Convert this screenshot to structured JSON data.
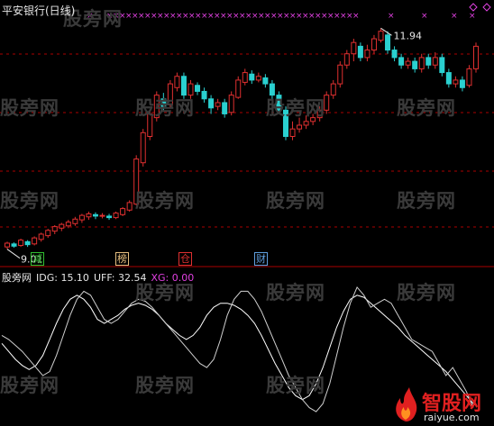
{
  "window": {
    "title": "平安银行(日线)"
  },
  "price_chart": {
    "high_label": "11.94",
    "low_label": "9.01",
    "signals": [
      {
        "text": "减",
        "color": "#30c030"
      },
      {
        "text": "榜",
        "color": "#e8c080"
      },
      {
        "text": "仓",
        "color": "#e03030"
      },
      {
        "text": "财",
        "color": "#60a0e0"
      }
    ],
    "colors": {
      "up": "#e03030",
      "down": "#2ad0d0",
      "grid": "#aa0000",
      "marker": "#e040e0"
    }
  },
  "indicator": {
    "prefix": "股旁网",
    "idg": "IDG: 15.10",
    "uff": "UFF: 32.54",
    "xg": "XG: 0.00",
    "colors": {
      "prefix": "#e6e6e6",
      "idg": "#e6e6e6",
      "uff": "#e6e6e6",
      "xg": "#e040e0"
    }
  },
  "watermark": {
    "text": "股旁网"
  },
  "logo": {
    "main": "智股网",
    "sub": "raiyue.com"
  },
  "chart_data": {
    "type": "candlestick",
    "ylim": [
      8.9,
      12.1
    ],
    "candles": [
      [
        9.03,
        9.08,
        9.0,
        9.1
      ],
      [
        9.07,
        9.04,
        9.02,
        9.09
      ],
      [
        9.05,
        9.12,
        9.03,
        9.14
      ],
      [
        9.1,
        9.06,
        9.03,
        9.12
      ],
      [
        9.07,
        9.15,
        9.05,
        9.17
      ],
      [
        9.13,
        9.2,
        9.1,
        9.22
      ],
      [
        9.18,
        9.25,
        9.15,
        9.27
      ],
      [
        9.24,
        9.3,
        9.2,
        9.32
      ],
      [
        9.28,
        9.33,
        9.24,
        9.35
      ],
      [
        9.31,
        9.36,
        9.28,
        9.39
      ],
      [
        9.34,
        9.4,
        9.31,
        9.43
      ],
      [
        9.39,
        9.45,
        9.35,
        9.47
      ],
      [
        9.43,
        9.47,
        9.39,
        9.5
      ],
      [
        9.46,
        9.44,
        9.4,
        9.49
      ],
      [
        9.44,
        9.45,
        9.41,
        9.48
      ],
      [
        9.44,
        9.42,
        9.39,
        9.47
      ],
      [
        9.42,
        9.48,
        9.4,
        9.5
      ],
      [
        9.46,
        9.54,
        9.44,
        9.56
      ],
      [
        9.52,
        9.62,
        9.5,
        9.65
      ],
      [
        9.6,
        10.2,
        9.58,
        10.25
      ],
      [
        10.15,
        10.55,
        10.1,
        10.6
      ],
      [
        10.5,
        10.8,
        10.45,
        10.85
      ],
      [
        10.75,
        11.05,
        10.7,
        11.1
      ],
      [
        11.0,
        10.9,
        10.85,
        11.08
      ],
      [
        10.92,
        11.2,
        10.88,
        11.25
      ],
      [
        11.15,
        11.3,
        11.1,
        11.35
      ],
      [
        11.3,
        11.05,
        11.0,
        11.35
      ],
      [
        11.05,
        11.2,
        11.0,
        11.25
      ],
      [
        11.18,
        11.1,
        11.05,
        11.22
      ],
      [
        11.1,
        11.0,
        10.95,
        11.15
      ],
      [
        11.0,
        10.88,
        10.8,
        11.05
      ],
      [
        10.9,
        10.95,
        10.85,
        11.0
      ],
      [
        10.95,
        10.8,
        10.75,
        11.0
      ],
      [
        10.82,
        11.05,
        10.78,
        11.1
      ],
      [
        11.02,
        11.25,
        11.0,
        11.3
      ],
      [
        11.22,
        11.35,
        11.18,
        11.4
      ],
      [
        11.33,
        11.25,
        11.2,
        11.38
      ],
      [
        11.25,
        11.3,
        11.22,
        11.35
      ],
      [
        11.28,
        11.2,
        11.15,
        11.33
      ],
      [
        11.2,
        11.05,
        11.0,
        11.25
      ],
      [
        11.05,
        10.85,
        10.8,
        11.1
      ],
      [
        10.85,
        10.5,
        10.45,
        10.9
      ],
      [
        10.5,
        10.6,
        10.45,
        10.7
      ],
      [
        10.6,
        10.65,
        10.55,
        10.75
      ],
      [
        10.65,
        10.7,
        10.6,
        10.78
      ],
      [
        10.7,
        10.75,
        10.65,
        10.8
      ],
      [
        10.75,
        10.85,
        10.7,
        10.9
      ],
      [
        10.85,
        11.05,
        10.8,
        11.1
      ],
      [
        11.05,
        11.2,
        11.0,
        11.25
      ],
      [
        11.2,
        11.45,
        11.15,
        11.5
      ],
      [
        11.45,
        11.6,
        11.4,
        11.65
      ],
      [
        11.6,
        11.75,
        11.5,
        11.8
      ],
      [
        11.7,
        11.55,
        11.5,
        11.75
      ],
      [
        11.55,
        11.65,
        11.5,
        11.72
      ],
      [
        11.65,
        11.8,
        11.6,
        11.85
      ],
      [
        11.78,
        11.9,
        11.75,
        11.94
      ],
      [
        11.85,
        11.65,
        11.6,
        11.9
      ],
      [
        11.65,
        11.55,
        11.5,
        11.7
      ],
      [
        11.55,
        11.45,
        11.4,
        11.6
      ],
      [
        11.45,
        11.5,
        11.4,
        11.55
      ],
      [
        11.5,
        11.4,
        11.35,
        11.55
      ],
      [
        11.4,
        11.55,
        11.35,
        11.6
      ],
      [
        11.55,
        11.45,
        11.4,
        11.6
      ],
      [
        11.45,
        11.55,
        11.4,
        11.62
      ],
      [
        11.55,
        11.35,
        11.3,
        11.6
      ],
      [
        11.35,
        11.2,
        11.15,
        11.4
      ],
      [
        11.2,
        11.25,
        11.15,
        11.3
      ],
      [
        11.25,
        11.15,
        11.1,
        11.3
      ],
      [
        11.18,
        11.4,
        11.15,
        11.45
      ],
      [
        11.4,
        11.7,
        11.35,
        11.75
      ]
    ],
    "indicator": {
      "series": [
        {
          "name": "IDG",
          "values": [
            38,
            34,
            30,
            27,
            25,
            27,
            32,
            40,
            48,
            55,
            60,
            62,
            60,
            56,
            50,
            48,
            50,
            52,
            55,
            57,
            58,
            57,
            55,
            52,
            48,
            45,
            42,
            40,
            42,
            46,
            52,
            56,
            58,
            58,
            57,
            55,
            52,
            48,
            42,
            35,
            28,
            22,
            16,
            12,
            10,
            12,
            18,
            26,
            36,
            46,
            54,
            60,
            62,
            61,
            58,
            55,
            52,
            49,
            46,
            42,
            39,
            36,
            33,
            30,
            27,
            24,
            20,
            16,
            12,
            8
          ]
        },
        {
          "name": "UFF",
          "values": [
            42,
            40,
            37,
            34,
            30,
            26,
            22,
            24,
            32,
            42,
            52,
            60,
            64,
            62,
            56,
            50,
            48,
            50,
            54,
            58,
            60,
            59,
            56,
            52,
            48,
            44,
            40,
            36,
            32,
            28,
            26,
            30,
            40,
            52,
            60,
            64,
            64,
            60,
            54,
            46,
            38,
            30,
            22,
            16,
            10,
            6,
            4,
            8,
            18,
            32,
            46,
            58,
            66,
            62,
            56,
            58,
            60,
            58,
            52,
            46,
            40,
            38,
            36,
            34,
            28,
            22,
            26,
            20,
            14,
            6
          ]
        }
      ],
      "ylim": [
        0,
        70
      ]
    }
  }
}
